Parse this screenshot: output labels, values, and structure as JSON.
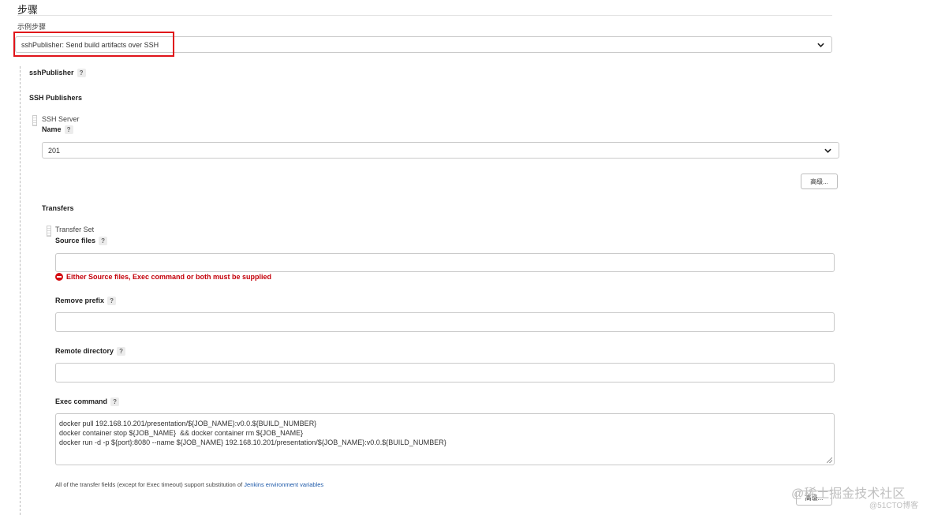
{
  "section": {
    "title": "步骤",
    "sample_step_label": "示例步骤"
  },
  "step_select": {
    "value": "sshPublisher: Send build artifacts over SSH"
  },
  "ssh_publisher": {
    "label": "sshPublisher",
    "help": "?",
    "publishers_label": "SSH Publishers",
    "server": {
      "header": "SSH Server",
      "name_label": "Name",
      "name_help": "?",
      "name_value": "201",
      "advanced_label": "高级..."
    },
    "transfers": {
      "label": "Transfers",
      "set_header": "Transfer Set",
      "source_files": {
        "label": "Source files",
        "help": "?",
        "value": ""
      },
      "error": "Either Source files, Exec command or both must be supplied",
      "remove_prefix": {
        "label": "Remove prefix",
        "help": "?",
        "value": ""
      },
      "remote_directory": {
        "label": "Remote directory",
        "help": "?",
        "value": ""
      },
      "exec_command": {
        "label": "Exec command",
        "help": "?",
        "value": "docker pull 192.168.10.201/presentation/${JOB_NAME}:v0.0.${BUILD_NUMBER}\ndocker container stop ${JOB_NAME}  && docker container rm ${JOB_NAME}\ndocker run -d -p ${port}:8080 --name ${JOB_NAME} 192.168.10.201/presentation/${JOB_NAME}:v0.0.${BUILD_NUMBER}"
      },
      "note_prefix": "All of the transfer fields (except for Exec timeout) support substitution of ",
      "note_link": "Jenkins environment variables",
      "advanced_label": "高级..."
    }
  },
  "watermark": {
    "line1": "@稀土掘金技术社区",
    "line2": "@51CTO博客"
  },
  "colors": {
    "highlight": "#e0141a",
    "error": "#c4000a",
    "link": "#1a57a8"
  }
}
